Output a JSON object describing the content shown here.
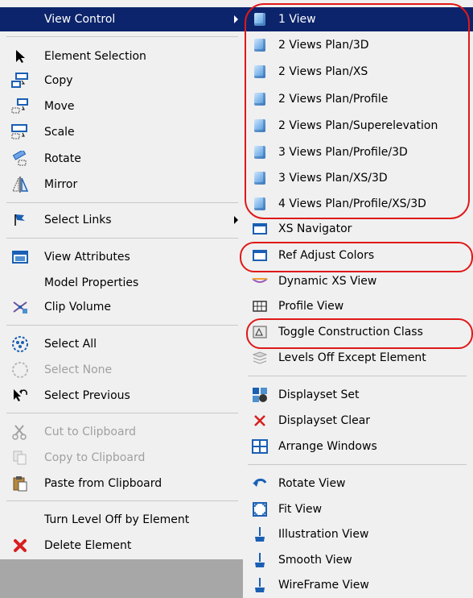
{
  "left_menu": {
    "view_control_label": "View Control",
    "items": [
      {
        "label": "Element Selection",
        "icon": "arrow-cursor-icon"
      },
      {
        "label": "Copy",
        "icon": "copy-icon"
      },
      {
        "label": "Move",
        "icon": "move-icon"
      },
      {
        "label": "Scale",
        "icon": "scale-icon"
      },
      {
        "label": "Rotate",
        "icon": "rotate-icon"
      },
      {
        "label": "Mirror",
        "icon": "mirror-icon"
      },
      {
        "label": "Select Links",
        "icon": "flag-icon"
      },
      {
        "label": "View Attributes",
        "icon": "view-attributes-icon"
      },
      {
        "label": "Model Properties",
        "icon": ""
      },
      {
        "label": "Clip Volume",
        "icon": "clip-volume-icon"
      },
      {
        "label": "Select All",
        "icon": "select-all-icon"
      },
      {
        "label": "Select None",
        "icon": "select-none-icon"
      },
      {
        "label": "Select Previous",
        "icon": "select-previous-icon"
      },
      {
        "label": "Cut to Clipboard",
        "icon": "scissors-icon"
      },
      {
        "label": "Copy to Clipboard",
        "icon": "copy-clipboard-icon"
      },
      {
        "label": "Paste from Clipboard",
        "icon": "paste-icon"
      },
      {
        "label": "Turn Level Off by Element",
        "icon": ""
      },
      {
        "label": "Delete Element",
        "icon": "delete-x-icon"
      }
    ]
  },
  "right_menu": {
    "items": [
      {
        "label": "1 View",
        "icon": "view-cube-icon"
      },
      {
        "label": "2 Views Plan/3D",
        "icon": "view-cube-icon"
      },
      {
        "label": "2 Views Plan/XS",
        "icon": "view-cube-icon"
      },
      {
        "label": "2 Views Plan/Profile",
        "icon": "view-cube-icon"
      },
      {
        "label": "2 Views Plan/Superelevation",
        "icon": "view-cube-icon"
      },
      {
        "label": "3 Views Plan/Profile/3D",
        "icon": "view-cube-icon"
      },
      {
        "label": "3 Views Plan/XS/3D",
        "icon": "view-cube-icon"
      },
      {
        "label": "4 Views Plan/Profile/XS/3D",
        "icon": "view-cube-icon"
      },
      {
        "label": "XS Navigator",
        "icon": "xs-navigator-icon"
      },
      {
        "label": "Ref Adjust Colors",
        "icon": "ref-adjust-colors-icon"
      },
      {
        "label": "Dynamic XS View",
        "icon": "dynamic-xs-icon"
      },
      {
        "label": "Profile View",
        "icon": "profile-grid-icon"
      },
      {
        "label": "Toggle Construction Class",
        "icon": "construction-class-icon"
      },
      {
        "label": "Levels Off Except Element",
        "icon": "levels-icon"
      },
      {
        "label": "Displayset Set",
        "icon": "displayset-set-icon"
      },
      {
        "label": "Displayset Clear",
        "icon": "displayset-clear-icon"
      },
      {
        "label": "Arrange Windows",
        "icon": "arrange-windows-icon"
      },
      {
        "label": "Rotate View",
        "icon": "rotate-view-icon"
      },
      {
        "label": "Fit View",
        "icon": "fit-view-icon"
      },
      {
        "label": "Illustration View",
        "icon": "brush-icon"
      },
      {
        "label": "Smooth View",
        "icon": "brush-icon"
      },
      {
        "label": "WireFrame View",
        "icon": "brush-icon"
      }
    ]
  },
  "colors": {
    "highlight_bg": "#0c246b",
    "annotation_red": "#e01818",
    "menu_bg": "#f0f0f0",
    "disabled_text": "#a0a0a0"
  }
}
